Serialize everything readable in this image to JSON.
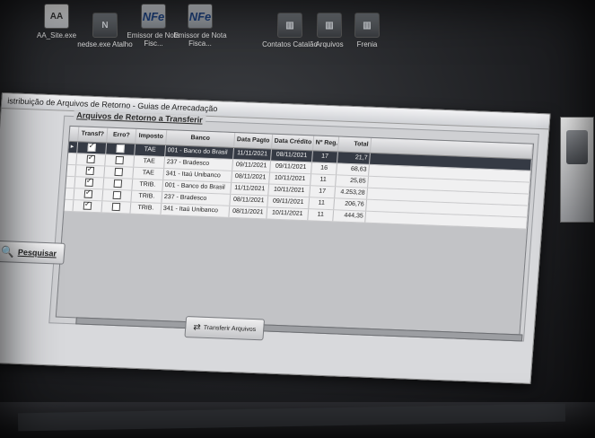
{
  "desktop": {
    "icons_top": [
      {
        "label": "AA_Site.exe",
        "glyph": "AA"
      },
      {
        "label": "nedse.exe Atalho",
        "glyph": "N"
      },
      {
        "label": "Emissor de Nota Fisc...",
        "glyph": "NFe"
      },
      {
        "label": "Emissor de Nota Fisca...",
        "glyph": "NFe"
      },
      {
        "label": "Contatos Catalão",
        "glyph": "▥"
      },
      {
        "label": "Arquivos",
        "glyph": "▥"
      },
      {
        "label": "Frenia",
        "glyph": "▥"
      }
    ]
  },
  "window": {
    "title": "istribuição de Arquivos de Retorno - Guias de Arrecadação",
    "group_title": "Arquivos de Retorno a Transferir",
    "columns": {
      "transf": "Transf?",
      "erro": "Erro?",
      "imposto": "Imposto",
      "banco": "Banco",
      "data_pagto": "Data Pagto",
      "data_credito": "Data Crédito",
      "nreg": "Nº Reg. Arq.",
      "valor": "Total"
    },
    "rows": [
      {
        "transf": true,
        "erro": false,
        "imposto": "TAE",
        "banco": "001 - Banco do Brasil",
        "data_pagto": "11/11/2021",
        "data_credito": "08/11/2021",
        "nreg": "17",
        "valor": "21,7",
        "extra": "",
        "selected": true
      },
      {
        "transf": true,
        "erro": false,
        "imposto": "TAE",
        "banco": "237 - Bradesco",
        "data_pagto": "09/11/2021",
        "data_credito": "09/11/2021",
        "nreg": "16",
        "valor": "68,63",
        "extra": "",
        "selected": false
      },
      {
        "transf": true,
        "erro": false,
        "imposto": "TAE",
        "banco": "341 - Itaú Unibanco",
        "data_pagto": "08/11/2021",
        "data_credito": "10/11/2021",
        "nreg": "11",
        "valor": "25,85",
        "extra": "",
        "selected": false
      },
      {
        "transf": true,
        "erro": false,
        "imposto": "TRIB.",
        "banco": "001 - Banco do Brasil",
        "data_pagto": "11/11/2021",
        "data_credito": "10/11/2021",
        "nreg": "17",
        "valor": "4.253,28",
        "extra": "",
        "selected": false
      },
      {
        "transf": true,
        "erro": false,
        "imposto": "TRIB.",
        "banco": "237 - Bradesco",
        "data_pagto": "08/11/2021",
        "data_credito": "09/11/2021",
        "nreg": "11",
        "valor": "206,76",
        "extra": "",
        "selected": false
      },
      {
        "transf": true,
        "erro": false,
        "imposto": "TRIB.",
        "banco": "341 - Itaú Unibanco",
        "data_pagto": "08/11/2021",
        "data_credito": "10/11/2021",
        "nreg": "11",
        "valor": "444,35",
        "extra": "",
        "selected": false
      }
    ],
    "pesquisar_label": "Pesquisar",
    "transferir_label": "Transferir Arquivos",
    "progress": 0.0
  }
}
